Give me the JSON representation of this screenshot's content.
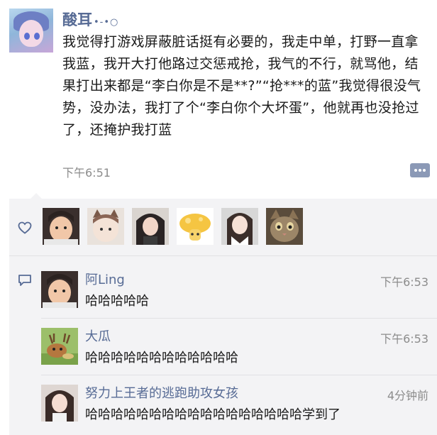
{
  "post": {
    "username": "酸耳",
    "username_deco": "•-•○",
    "text": "我觉得打游戏屏蔽脏话挺有必要的，我走中单，打野一直拿我蓝，我开大打他路过交惩戒抢，我气的不行，就骂他，结果打出来都是“李白你是不是**?”“抢***的蓝”我觉得很没气势，没办法，我打了个“李白你个大坏蛋”，他就再也没抢过了，还掩护我打蓝",
    "time": "下午6:51"
  },
  "likes": {
    "icon": "heart-icon",
    "avatars": [
      "baby-avatar",
      "cat-boy-avatar",
      "girl-avatar",
      "mushroom-avatar",
      "girl-portrait-avatar",
      "cat-avatar"
    ]
  },
  "comments": [
    {
      "name": "阿Ling",
      "time": "下午6:53",
      "text": "哈哈哈哈哈"
    },
    {
      "name": "大瓜",
      "time": "下午6:53",
      "text": "哈哈哈哈哈哈哈哈哈哈哈哈"
    },
    {
      "name": "努力上王者的逃跑助攻女孩",
      "time": "4分钟前",
      "text": "哈哈哈哈哈哈哈哈哈哈哈哈哈哈哈哈哈学到了"
    }
  ],
  "colors": {
    "name": "#576b95",
    "panel": "#f3f3f5",
    "meta": "#8c8c8c"
  }
}
